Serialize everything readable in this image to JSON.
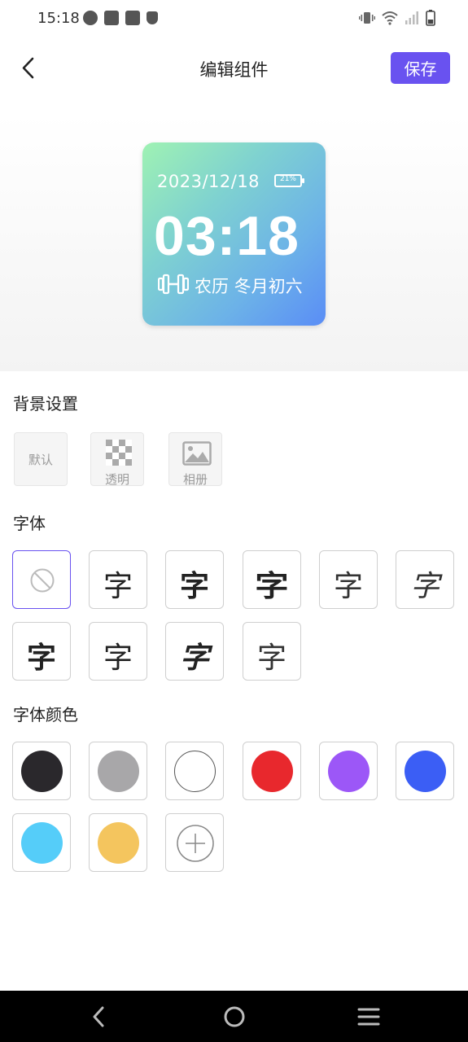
{
  "status_bar": {
    "time": "15:18"
  },
  "header": {
    "title": "编辑组件",
    "save_label": "保存"
  },
  "widget": {
    "date": "2023/12/18",
    "battery": "21%",
    "time": "03:18",
    "lunar": "农历 冬月初六",
    "background_gradient": [
      "#9ff2b3",
      "#5a8df6"
    ]
  },
  "background_section": {
    "title": "背景设置",
    "options": [
      {
        "label": "默认"
      },
      {
        "label": "透明",
        "icon": "checkerboard-icon"
      },
      {
        "label": "相册",
        "icon": "image-icon"
      }
    ]
  },
  "font_section": {
    "title": "字体",
    "none_icon": "ban-icon",
    "samples": [
      "字",
      "字",
      "字",
      "字",
      "字",
      "字",
      "字",
      "字",
      "字"
    ]
  },
  "color_section": {
    "title": "字体颜色",
    "colors": [
      "#2a282c",
      "#a8a7a9",
      "#ffffff",
      "#e8282d",
      "#9c57f7",
      "#3b5ef5",
      "#55cdf9",
      "#f4c55e"
    ],
    "add_icon": "plus-circle-icon"
  },
  "accent_color": "#6952f0"
}
